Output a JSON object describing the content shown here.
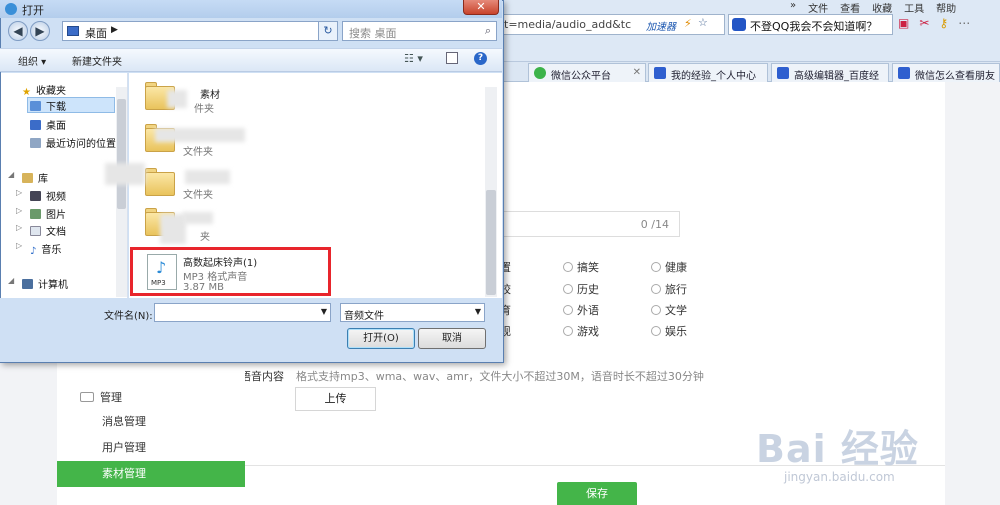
{
  "browser": {
    "menu": [
      "»",
      "文件",
      "查看",
      "收藏",
      "工具",
      "帮助"
    ],
    "address_tail": "t=media/audio_add&tc",
    "accelerator": "加速器",
    "search_text": "不登QQ我会不会知道啊？",
    "tabs": [
      {
        "label": "微信公众平台",
        "active": true
      },
      {
        "label": "我的经验_个人中心"
      },
      {
        "label": "高级编辑器_百度经"
      },
      {
        "label": "微信怎么查看朋友"
      }
    ]
  },
  "page": {
    "counter": "0 /14",
    "categories": [
      "搞笑",
      "健康",
      "历史",
      "旅行",
      "外语",
      "文学",
      "游戏",
      "娱乐"
    ],
    "left_fragments": [
      "置",
      "校",
      "育",
      "现"
    ],
    "voice_label": "语音内容",
    "voice_hint": "格式支持mp3、wma、wav、amr，文件大小不超过30M，语音时长不超过30分钟",
    "upload_label": "上传",
    "save_label": "保存",
    "watermark": "Bai 经验",
    "watermark_url": "jingyan.baidu.com"
  },
  "sidebar": {
    "heading": "管理",
    "items": [
      {
        "label": "消息管理"
      },
      {
        "label": "用户管理"
      },
      {
        "label": "素材管理",
        "selected": true
      }
    ]
  },
  "dialog": {
    "title": "打开",
    "close": "✕",
    "back": "◀",
    "forward": "▶",
    "path": "桌面",
    "path_sep": "▶",
    "search_placeholder": "搜索 桌面",
    "organize": "组织 ▾",
    "new_folder": "新建文件夹",
    "nav": {
      "favorites": "收藏夹",
      "downloads": "下载",
      "desktop": "桌面",
      "recent": "最近访问的位置",
      "libraries": "库",
      "videos": "视频",
      "pictures": "图片",
      "documents": "文档",
      "music": "音乐",
      "computer": "计算机"
    },
    "files": [
      {
        "name": "素材",
        "type": "件夹"
      },
      {
        "name": "",
        "type": "文件夹"
      },
      {
        "name": "",
        "type": "文件夹"
      },
      {
        "name": "",
        "type": "夹"
      }
    ],
    "mp3": {
      "name": "高数起床铃声(1)",
      "type": "MP3 格式声音",
      "size": "3.87 MB",
      "tag": "MP3"
    },
    "filename_label": "文件名(N):",
    "filename_value": "",
    "filetype": "音频文件",
    "open": "打开(O)",
    "cancel": "取消"
  }
}
